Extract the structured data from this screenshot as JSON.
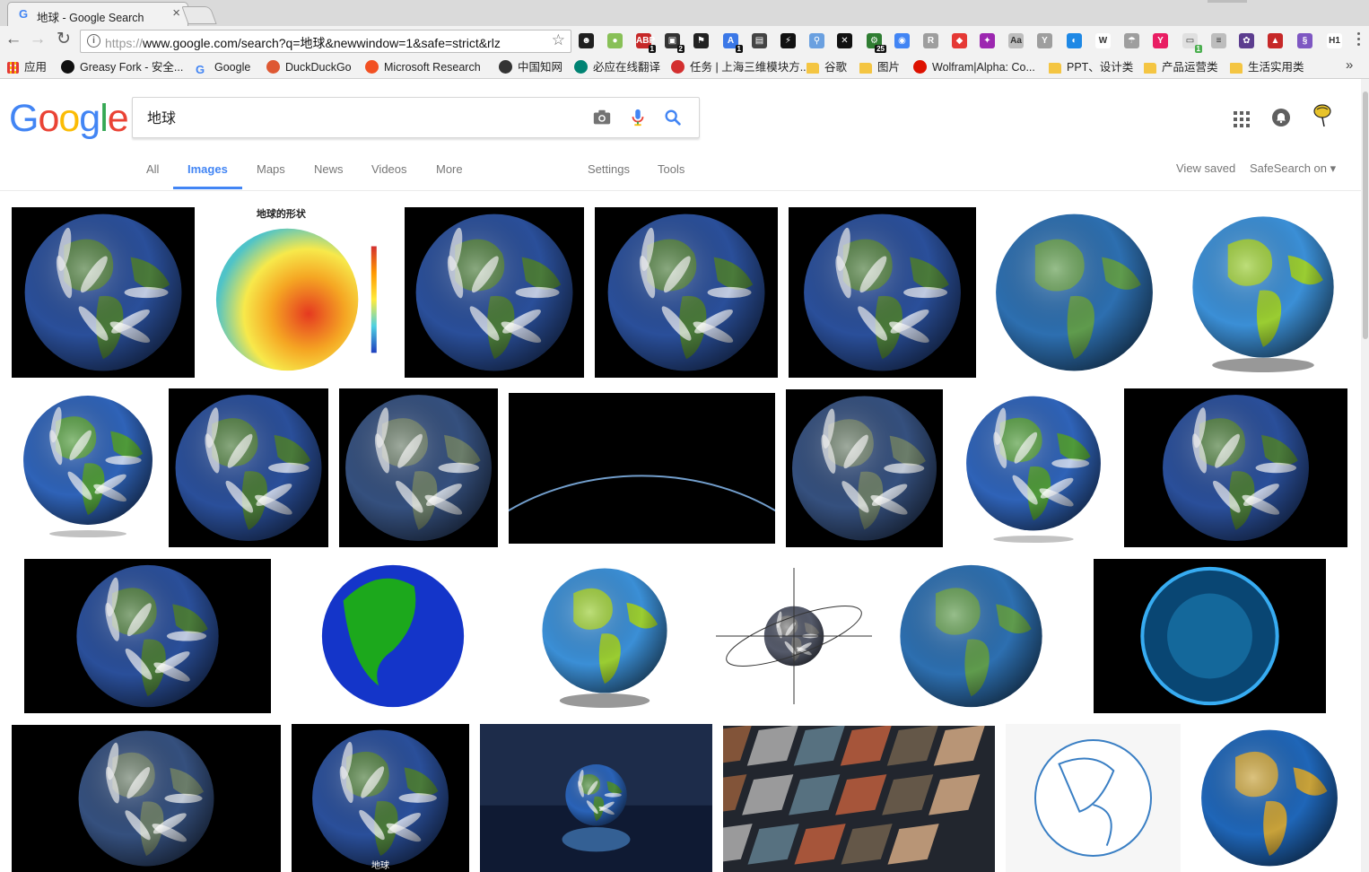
{
  "browser": {
    "tab_title": "地球 - Google Search",
    "tab_close": "×",
    "url_scheme": "https://",
    "url_rest": "www.google.com/search?q=地球&newwindow=1&safe=strict&rlz",
    "star": "☆"
  },
  "extensions": [
    {
      "name": "ext-icon-1",
      "color": "#202020",
      "label": "☻",
      "badge": ""
    },
    {
      "name": "ext-icon-2",
      "color": "#88c057",
      "label": "●",
      "badge": ""
    },
    {
      "name": "ext-icon-3",
      "color": "#c62828",
      "label": "ABP",
      "badge": "1"
    },
    {
      "name": "ext-icon-4",
      "color": "#333333",
      "label": "▣",
      "badge": "2"
    },
    {
      "name": "ext-icon-5",
      "color": "#222222",
      "label": "⚑",
      "badge": ""
    },
    {
      "name": "ext-icon-6",
      "color": "#3b78e7",
      "label": "A",
      "badge": "1"
    },
    {
      "name": "ext-icon-7",
      "color": "#444444",
      "label": "▤",
      "badge": ""
    },
    {
      "name": "ext-icon-8",
      "color": "#111111",
      "label": "⚡",
      "badge": ""
    },
    {
      "name": "ext-icon-9",
      "color": "#6aa0e0",
      "label": "⚲",
      "badge": ""
    },
    {
      "name": "ext-icon-10",
      "color": "#111111",
      "label": "✕",
      "badge": ""
    },
    {
      "name": "ext-icon-11",
      "color": "#2f7d32",
      "label": "⚙",
      "badge": "25"
    },
    {
      "name": "ext-icon-12",
      "color": "#4285f4",
      "label": "◉",
      "badge": ""
    },
    {
      "name": "ext-icon-13",
      "color": "#9e9e9e",
      "label": "R",
      "badge": ""
    },
    {
      "name": "ext-icon-14",
      "color": "#e53935",
      "label": "◆",
      "badge": ""
    },
    {
      "name": "ext-icon-15",
      "color": "#9c27b0",
      "label": "✦",
      "badge": ""
    },
    {
      "name": "ext-icon-16",
      "color": "#bdbdbd",
      "label": "Aa",
      "badge": ""
    },
    {
      "name": "ext-icon-17",
      "color": "#9e9e9e",
      "label": "Y",
      "badge": ""
    },
    {
      "name": "ext-icon-18",
      "color": "#1e88e5",
      "label": "◐",
      "badge": ""
    },
    {
      "name": "ext-icon-19",
      "color": "#ffffff",
      "label": "W",
      "badge": ""
    },
    {
      "name": "ext-icon-20",
      "color": "#9e9e9e",
      "label": "☂",
      "badge": ""
    },
    {
      "name": "ext-icon-21",
      "color": "#e91e63",
      "label": "Y",
      "badge": ""
    },
    {
      "name": "ext-icon-22",
      "color": "#e0e0e0",
      "label": "▭",
      "badge": "1"
    },
    {
      "name": "ext-icon-23",
      "color": "#bdbdbd",
      "label": "≡",
      "badge": ""
    },
    {
      "name": "ext-icon-24",
      "color": "#5c3d8f",
      "label": "✿",
      "badge": ""
    },
    {
      "name": "ext-icon-25",
      "color": "#c62828",
      "label": "▲",
      "badge": ""
    },
    {
      "name": "ext-icon-26",
      "color": "#7e57c2",
      "label": "§",
      "badge": ""
    },
    {
      "name": "ext-icon-27",
      "color": "#ffffff",
      "label": "H1",
      "badge": ""
    }
  ],
  "bookmarks": [
    {
      "label": "应用",
      "icon": "apps-grid-icon",
      "color": "#e53935"
    },
    {
      "label": "Greasy Fork - 安全...",
      "icon": "greasyfork-icon",
      "color": "#111111"
    },
    {
      "label": "Google",
      "icon": "google-icon",
      "color": "#4285f4"
    },
    {
      "label": "DuckDuckGo",
      "icon": "duckduckgo-icon",
      "color": "#de5833"
    },
    {
      "label": "Microsoft Research",
      "icon": "microsoft-icon",
      "color": "#f25022"
    },
    {
      "label": "中国知网",
      "icon": "cnki-icon",
      "color": "#333333"
    },
    {
      "label": "必应在线翻译",
      "icon": "bing-icon",
      "color": "#008373"
    },
    {
      "label": "任务 | 上海三维模块方...",
      "icon": "task-icon",
      "color": "#d32f2f"
    },
    {
      "label": "谷歌",
      "icon": "folder-icon",
      "color": "#f4c542"
    },
    {
      "label": "图片",
      "icon": "folder-icon",
      "color": "#f4c542"
    },
    {
      "label": "Wolfram|Alpha: Co...",
      "icon": "wolfram-icon",
      "color": "#dd1100"
    },
    {
      "label": "PPT、设计类",
      "icon": "folder-icon",
      "color": "#f4c542"
    },
    {
      "label": "产品运营类",
      "icon": "folder-icon",
      "color": "#f4c542"
    },
    {
      "label": "生活实用类",
      "icon": "folder-icon",
      "color": "#f4c542"
    }
  ],
  "bookmarks_overflow": "»",
  "search": {
    "logo": [
      "G",
      "o",
      "o",
      "g",
      "l",
      "e"
    ],
    "query": "地球"
  },
  "tabs": {
    "items": [
      "All",
      "Images",
      "Maps",
      "News",
      "Videos",
      "More"
    ],
    "active": "Images",
    "settings": "Settings",
    "tools": "Tools",
    "view_saved": "View saved",
    "safesearch": "SafeSearch on ▾"
  },
  "image_results": [
    {
      "style": "photo"
    },
    {
      "style": "elevation",
      "title": "地球的形状"
    },
    {
      "style": "photo"
    },
    {
      "style": "photo"
    },
    {
      "style": "photo"
    },
    {
      "style": "stylized"
    },
    {
      "style": "cartoon"
    },
    {
      "style": "white"
    },
    {
      "style": "photo"
    },
    {
      "style": "gray"
    },
    {
      "style": "horizon"
    },
    {
      "style": "gray"
    },
    {
      "style": "white"
    },
    {
      "style": "photo"
    },
    {
      "style": "photo"
    },
    {
      "style": "flat"
    },
    {
      "style": "cartoon"
    },
    {
      "style": "diagram"
    },
    {
      "style": "stylized"
    },
    {
      "style": "glow"
    },
    {
      "style": "gray"
    },
    {
      "style": "photo",
      "caption": "地球"
    },
    {
      "style": "reflection"
    },
    {
      "style": "collage"
    },
    {
      "style": "sketch"
    },
    {
      "style": "topo"
    }
  ],
  "colors": {
    "accent": "#4285f4",
    "ocean": "#1f4fa6",
    "land": "#3c8a3a"
  }
}
